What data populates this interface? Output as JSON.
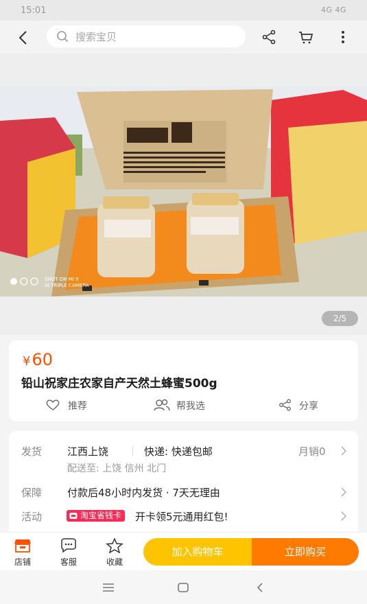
{
  "status_bar": {
    "time": "15:01",
    "signal": "4G 4G"
  },
  "header": {
    "search_placeholder": "搜索宝贝"
  },
  "gallery": {
    "camera_text": "SHOT ON MI 9\nAI TRIPLE CAMERA",
    "page_indicator": "2/5"
  },
  "product": {
    "currency": "¥",
    "price": "60",
    "title": "铅山祝家庄农家自产天然土蜂蜜500g",
    "actions": {
      "recommend": "推荐",
      "help_choose": "帮我选",
      "share": "分享"
    }
  },
  "details": {
    "ship_label": "发货",
    "origin": "江西上饶",
    "delivery": "快递: 快递包邮",
    "monthly_sales": "月销0",
    "deliver_to": "配送至: 上饶 信州 北门",
    "guarantee_label": "保障",
    "guarantee": "付款后48小时内发货 · 7天无理由",
    "promo_label": "活动",
    "promo_badge": "淘宝省钱卡",
    "promo_text": "开卡领5元通用红包!"
  },
  "bottom_bar": {
    "store": "店铺",
    "service": "客服",
    "favorite": "收藏",
    "add_to_cart": "加入购物车",
    "buy_now": "立即购买"
  },
  "colors": {
    "price": "#ff5000",
    "cart_button": "#ffc400",
    "buy_button": "#ff7a00",
    "promo_badge": "#ff2a55"
  }
}
